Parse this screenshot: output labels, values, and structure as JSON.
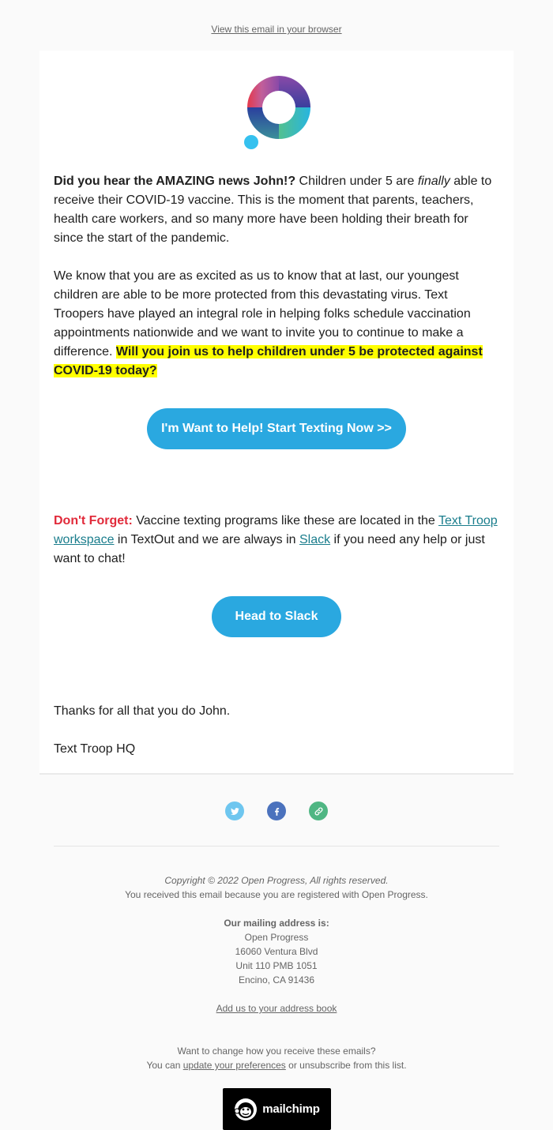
{
  "preheader": {
    "view_in_browser": "View this email in your browser"
  },
  "brand": {
    "logo_icon": "open-progress-logo-icon",
    "colors": {
      "button": "#2aa8e0",
      "highlight": "#ffff00",
      "alert_red": "#e12a3a",
      "link_teal": "#1a7d8c",
      "twitter": "#6ec6ef",
      "facebook": "#4b72bd",
      "link_icon": "#4fb683"
    }
  },
  "content": {
    "p1": {
      "lead_bold": "Did you hear the AMAZING news John!?",
      "text_a": " Children under 5 are ",
      "italic": "finally",
      "text_b": " able to receive their COVID-19 vaccine. This is the moment that parents, teachers, health care workers, and so many more have been holding their breath for since the start of the pandemic."
    },
    "p2": {
      "text": "We know that you are as excited as us to know that at last, our youngest children are able to be more protected from this devastating virus. Text Troopers have played an integral role in helping folks schedule vaccination appointments nationwide and we want to invite you to continue to make a difference. ",
      "highlight": "Will you join us to help children under 5 be protected against COVID-19 today?"
    },
    "cta_primary": "I'm Want to Help! Start Texting Now >>",
    "p3": {
      "label": "Don't Forget:",
      "text_a": " Vaccine texting programs like these are located in the ",
      "link_workspace": "Text Troop workspace",
      "text_b": " in TextOut and we are always in ",
      "link_slack": "Slack",
      "text_c": " if you need any help or just want to chat!"
    },
    "cta_secondary": "Head to Slack >>",
    "thanks": "Thanks for all that you do John.",
    "signature": "Text Troop HQ"
  },
  "social": [
    {
      "name": "twitter",
      "icon": "twitter-icon"
    },
    {
      "name": "facebook",
      "icon": "facebook-icon"
    },
    {
      "name": "website",
      "icon": "link-icon"
    }
  ],
  "footer": {
    "copyright": "Copyright © 2022 Open Progress, All rights reserved.",
    "reason": "You received this email because you are registered with Open Progress.",
    "mailing_heading": "Our mailing address is:",
    "address": [
      "Open Progress",
      "16060 Ventura Blvd",
      "Unit 110 PMB 1051",
      "Encino, CA 91436"
    ],
    "add_to_address_book": "Add us to your address book",
    "change_prompt": "Want to change how you receive these emails?",
    "you_can": "You can ",
    "update_preferences": "update your preferences",
    "or_unsubscribe": " or unsubscribe from this list.",
    "badge_text": "mailchimp"
  }
}
